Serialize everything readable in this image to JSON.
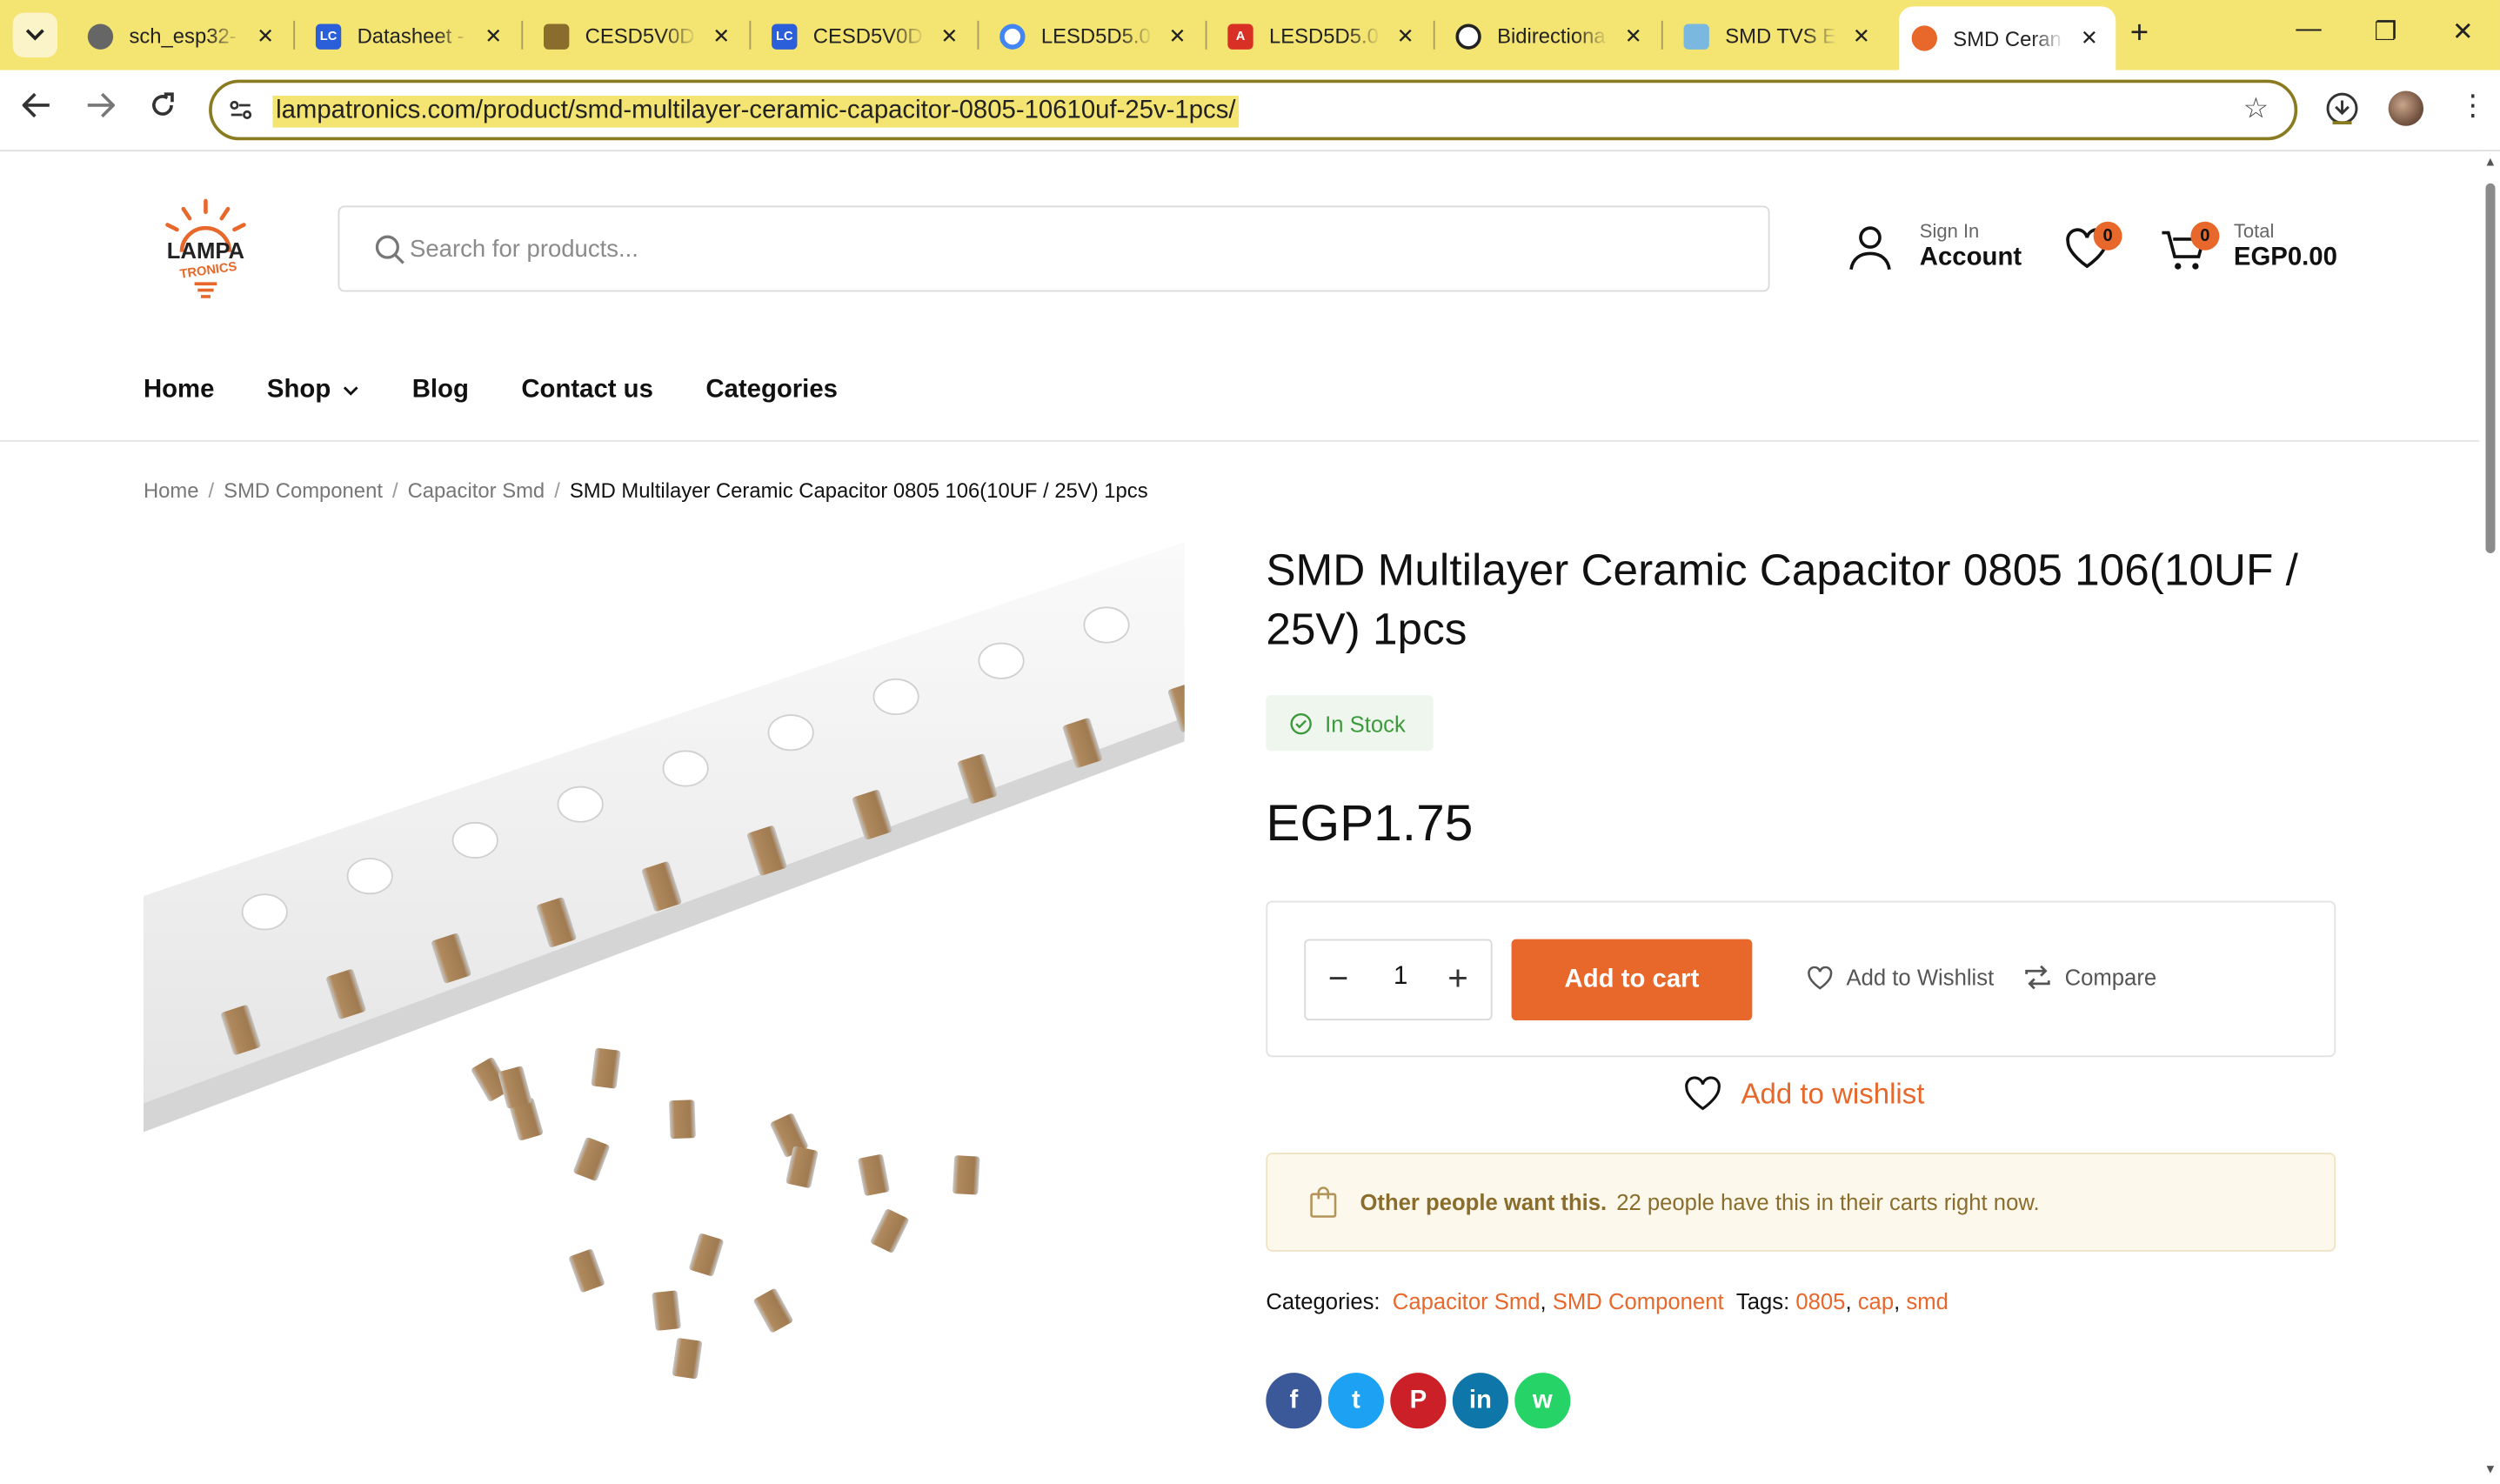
{
  "browser": {
    "tabs": [
      {
        "title": "sch_esp32-",
        "icon": "globe-icon",
        "color": "#555555"
      },
      {
        "title": "Datasheet -",
        "icon": "lc-icon",
        "color": "#2b5fd9"
      },
      {
        "title": "CESD5V0D",
        "icon": "dk-icon",
        "color": "#8a6d2c"
      },
      {
        "title": "CESD5V0D",
        "icon": "lc-icon",
        "color": "#2b5fd9"
      },
      {
        "title": "LESD5D5.0",
        "icon": "google-icon",
        "color": "#4285f4"
      },
      {
        "title": "LESD5D5.0",
        "icon": "pdf-icon",
        "color": "#d93025"
      },
      {
        "title": "Bidirectiona",
        "icon": "openai-icon",
        "color": "#222222"
      },
      {
        "title": "SMD TVS E",
        "icon": "wave-icon",
        "color": "#7ab8e0"
      },
      {
        "title": "SMD Ceran",
        "icon": "lampa-icon",
        "color": "#e8672a"
      }
    ],
    "url": "lampatronics.com/product/smd-multilayer-ceramic-capacitor-0805-10610uf-25v-1pcs/"
  },
  "header": {
    "logo_line1": "LAMPA",
    "logo_line2": "TRONICS",
    "search_placeholder": "Search for products...",
    "sign_in": "Sign In",
    "account": "Account",
    "wishlist_count": "0",
    "cart_count": "0",
    "total_label": "Total",
    "total_value": "EGP0.00"
  },
  "nav": {
    "items": [
      "Home",
      "Shop",
      "Blog",
      "Contact us",
      "Categories"
    ]
  },
  "breadcrumb": {
    "items": [
      "Home",
      "SMD Component",
      "Capacitor Smd"
    ],
    "current": "SMD Multilayer Ceramic Capacitor 0805 106(10UF / 25V) 1pcs"
  },
  "product": {
    "title": "SMD Multilayer Ceramic Capacitor 0805 106(10UF / 25V) 1pcs",
    "stock": "In Stock",
    "price": "EGP1.75",
    "quantity": "1",
    "add_to_cart": "Add to cart",
    "add_to_wishlist": "Add to Wishlist",
    "compare": "Compare",
    "add_to_wishlist_big": "Add to wishlist",
    "notice_bold": "Other people want this.",
    "notice_text": "22 people have this in their carts right now.",
    "categories_label": "Categories:",
    "categories": [
      "Capacitor Smd",
      "SMD Component"
    ],
    "tags_label": "Tags:",
    "tags": [
      "0805",
      "cap",
      "smd"
    ]
  },
  "social": [
    {
      "name": "facebook",
      "glyph": "f",
      "color": "#3b5998"
    },
    {
      "name": "twitter",
      "glyph": "t",
      "color": "#1da1f2"
    },
    {
      "name": "pinterest",
      "glyph": "P",
      "color": "#cb2027"
    },
    {
      "name": "linkedin",
      "glyph": "in",
      "color": "#0e76a8"
    },
    {
      "name": "whatsapp",
      "glyph": "w",
      "color": "#25d366"
    }
  ],
  "colors": {
    "accent": "#e8672a",
    "chrome": "#f4e472"
  }
}
